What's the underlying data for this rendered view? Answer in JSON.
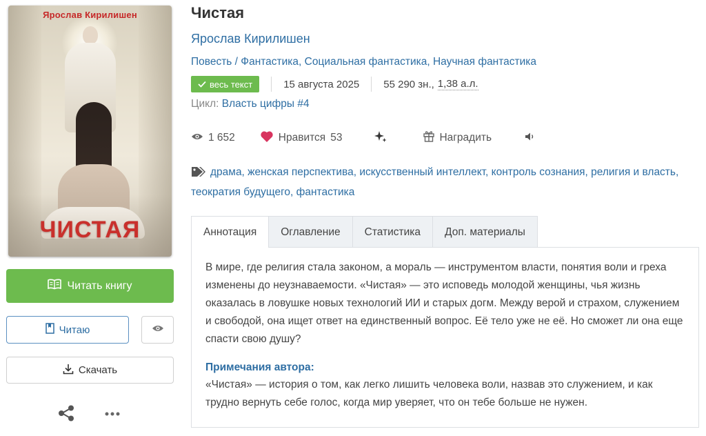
{
  "cover": {
    "author": "Ярослав Кирилишен",
    "title": "ЧИСТАЯ"
  },
  "actions": {
    "read_label": "Читать книгу",
    "reading_label": "Читаю",
    "download_label": "Скачать"
  },
  "book": {
    "title": "Чистая",
    "author": "Ярослав Кирилишен",
    "genres": "Повесть / Фантастика, Социальная фантастика, Научная фантастика",
    "badge": "весь текст",
    "date": "15 августа 2025",
    "chars": "55 290 зн.,",
    "sheets": "1,38 а.л.",
    "cycle_label": "Цикл:",
    "cycle": "Власть цифры #4"
  },
  "stats": {
    "views": "1 652",
    "likes_label": "Нравится",
    "likes_count": "53",
    "reward_label": "Наградить"
  },
  "tags": "драма, женская перспектива, искусственный интеллект, контроль сознания, религия и власть, теократия будущего, фантастика",
  "tabs": [
    {
      "label": "Аннотация"
    },
    {
      "label": "Оглавление"
    },
    {
      "label": "Статистика"
    },
    {
      "label": "Доп. материалы"
    }
  ],
  "annotation": "В мире, где религия стала законом, а мораль — инструментом власти, понятия воли и греха изменены до неузнаваемости. «Чистая» — это исповедь молодой женщины, чья жизнь оказалась в ловушке новых технологий ИИ и старых догм. Между верой и стра­хом, служением и свободой, она ищет ответ на единственный вопрос. Её тело уже не её. Но сможет ли она еще спасти свою душу?",
  "notes": {
    "title": "Примечания автора:",
    "text": "«Чистая» — история о том, как легко лишить человека воли, назвав это служением, и как трудно вернуть себе голос, когда мир уверяет, что он тебе больше не нужен."
  },
  "colors": {
    "accent_green": "#6dbb4e",
    "link_blue": "#2e6ea3",
    "heart_red": "#d8345f"
  },
  "icons": [
    "book-open-icon",
    "bookmark-icon",
    "eye-icon",
    "download-icon",
    "share-icon",
    "more-icon",
    "check-icon",
    "views-icon",
    "heart-icon",
    "sparkle-icon",
    "gift-icon",
    "speaker-icon",
    "tag-icon"
  ]
}
